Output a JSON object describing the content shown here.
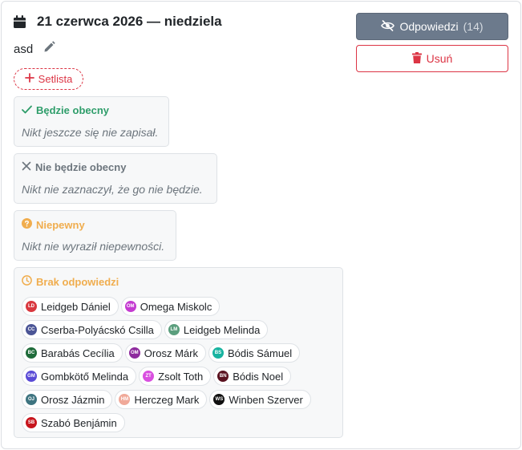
{
  "event": {
    "title": "21 czerwca 2026 — niedziela",
    "description": "asd",
    "setlist_label": "Setlista"
  },
  "actions": {
    "answers_label": "Odpowiedzi",
    "answers_count": "(14)",
    "delete_label": "Usuń"
  },
  "groups": {
    "yes": {
      "label": "Będzie obecny",
      "empty": "Nikt jeszcze się nie zapisał."
    },
    "no": {
      "label": "Nie będzie obecny",
      "empty": "Nikt nie zaznaczył, że go nie będzie."
    },
    "maybe": {
      "label": "Niepewny",
      "empty": "Nikt nie wyraził niepewności."
    },
    "none": {
      "label": "Brak odpowiedzi"
    }
  },
  "no_answer_people": [
    {
      "initials": "LD",
      "name": "Leidgeb Dániel",
      "color": "#d9383f"
    },
    {
      "initials": "OM",
      "name": "Omega Miskolc",
      "color": "#c43bd1"
    },
    {
      "initials": "CC",
      "name": "Cserba-Polyácskó Csilla",
      "color": "#4b5596"
    },
    {
      "initials": "LM",
      "name": "Leidgeb Melinda",
      "color": "#5a9e7d"
    },
    {
      "initials": "BC",
      "name": "Barabás Cecília",
      "color": "#1f6b3a"
    },
    {
      "initials": "OM",
      "name": "Orosz Márk",
      "color": "#8e2a9e"
    },
    {
      "initials": "BS",
      "name": "Bódis Sámuel",
      "color": "#17b3a0"
    },
    {
      "initials": "GM",
      "name": "Gombkötő Melinda",
      "color": "#5a4bd6"
    },
    {
      "initials": "ZT",
      "name": "Zsolt Toth",
      "color": "#d94fe0"
    },
    {
      "initials": "BN",
      "name": "Bódis Noel",
      "color": "#5a1220"
    },
    {
      "initials": "OJ",
      "name": "Orosz Jázmin",
      "color": "#3e7480"
    },
    {
      "initials": "HM",
      "name": "Herczeg Mark",
      "color": "#f0a999"
    },
    {
      "initials": "WS",
      "name": "Winben Szerver",
      "color": "#111111"
    },
    {
      "initials": "SB",
      "name": "Szabó Benjámin",
      "color": "#c7151d"
    }
  ],
  "colors": {
    "danger": "#dc3545",
    "success": "#2e9d6a",
    "warning": "#f0ad4e",
    "secondary_button": "#6c7a8c"
  },
  "icons": {
    "title": "calendar-icon",
    "edit": "pencil-icon",
    "setlist": "plus-icon",
    "answers": "eye-slash-icon",
    "delete": "trash-icon",
    "yes": "check-icon",
    "no": "x-icon",
    "maybe": "question-circle-icon",
    "none": "clock-icon"
  }
}
